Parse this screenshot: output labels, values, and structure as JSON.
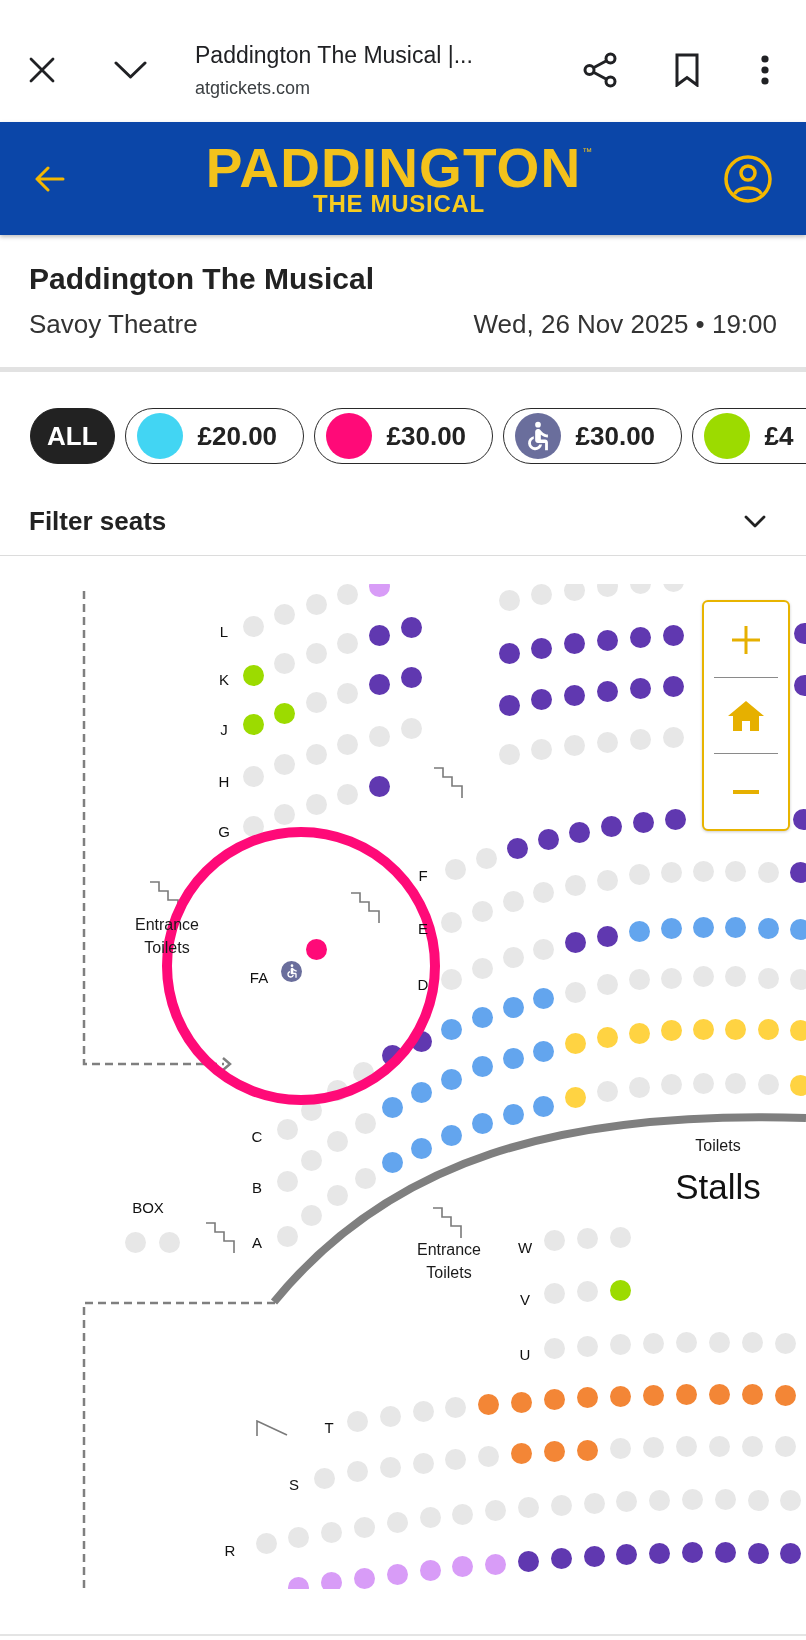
{
  "browser": {
    "title": "Paddington The Musical |...",
    "url": "atgtickets.com"
  },
  "banner": {
    "logo": "PADDINGTON",
    "logo_mark": "™",
    "tagline": "THE MUSICAL"
  },
  "event": {
    "title": "Paddington The Musical",
    "venue": "Savoy Theatre",
    "date": "Wed, 26 Nov 2025 • 19:00"
  },
  "price_filters": [
    {
      "kind": "all",
      "label": "ALL",
      "selected": true
    },
    {
      "kind": "price",
      "label": "£20.00",
      "color": "#42d5f3",
      "selected": false
    },
    {
      "kind": "price",
      "label": "£30.00",
      "color": "#ff0a78",
      "selected": false
    },
    {
      "kind": "access",
      "label": "£30.00",
      "color": "#6a6e9c",
      "selected": false
    },
    {
      "kind": "price",
      "label": "£4",
      "color": "#9cdb00",
      "selected": false
    }
  ],
  "filter": {
    "label": "Filter seats",
    "expanded": false
  },
  "seat_map": {
    "section": "Stalls",
    "area_labels": [
      "Entrance Toilets",
      "Entrance Toilets",
      "Toilets"
    ],
    "rows": [
      {
        "label": "L",
        "seats": [
          {
            "color": "#e7e7e7"
          },
          {
            "color": "#e7e7e7"
          },
          {
            "color": "#e7e7e7"
          },
          {
            "color": "#e7e7e7"
          },
          {
            "color": "#d89cf7"
          }
        ]
      },
      {
        "label": "K",
        "seats": [
          {
            "color": "#9cdb00"
          },
          {
            "color": "#e7e7e7"
          },
          {
            "color": "#e7e7e7"
          },
          {
            "color": "#e7e7e7"
          },
          {
            "color": "#6038b0"
          },
          {
            "color": "#6038b0"
          }
        ]
      },
      {
        "label": "J",
        "seats": [
          {
            "color": "#9cdb00"
          },
          {
            "color": "#9cdb00"
          },
          {
            "color": "#e7e7e7"
          },
          {
            "color": "#e7e7e7"
          },
          {
            "color": "#6038b0"
          },
          {
            "color": "#6038b0"
          }
        ]
      },
      {
        "label": "H",
        "seats": [
          {
            "color": "#e7e7e7"
          },
          {
            "color": "#e7e7e7"
          },
          {
            "color": "#e7e7e7"
          },
          {
            "color": "#e7e7e7"
          },
          {
            "color": "#e7e7e7"
          },
          {
            "color": "#e7e7e7"
          }
        ]
      },
      {
        "label": "G",
        "seats": [
          {
            "color": "#e7e7e7"
          },
          {
            "color": "#e7e7e7"
          },
          {
            "color": "#e7e7e7"
          },
          {
            "color": "#e7e7e7"
          },
          {
            "color": "#6038b0"
          }
        ]
      },
      {
        "seats": [
          {
            "color": "#e7e7e7"
          },
          {
            "color": "#e7e7e7"
          },
          {
            "color": "#e7e7e7"
          },
          {
            "color": "#e7e7e7"
          },
          {
            "color": "#e7e7e7"
          },
          {
            "color": "#e7e7e7"
          }
        ]
      },
      {
        "seats": [
          {
            "color": "#6038b0"
          },
          {
            "color": "#6038b0"
          },
          {
            "color": "#6038b0"
          },
          {
            "color": "#6038b0"
          },
          {
            "color": "#6038b0"
          },
          {
            "color": "#6038b0"
          },
          {
            "color": "#6038b0"
          }
        ]
      },
      {
        "seats": [
          {
            "color": "#6038b0"
          },
          {
            "color": "#6038b0"
          },
          {
            "color": "#6038b0"
          },
          {
            "color": "#6038b0"
          },
          {
            "color": "#6038b0"
          },
          {
            "color": "#6038b0"
          },
          {
            "color": "#6038b0"
          }
        ]
      },
      {
        "seats": [
          {
            "color": "#e7e7e7"
          },
          {
            "color": "#e7e7e7"
          },
          {
            "color": "#e7e7e7"
          },
          {
            "color": "#e7e7e7"
          },
          {
            "color": "#e7e7e7"
          },
          {
            "color": "#e7e7e7"
          }
        ]
      },
      {
        "label": "F",
        "seats": [
          {
            "color": "#e7e7e7"
          },
          {
            "color": "#e7e7e7"
          },
          {
            "color": "#6038b0"
          },
          {
            "color": "#6038b0"
          },
          {
            "color": "#6038b0"
          },
          {
            "color": "#6038b0"
          },
          {
            "color": "#6038b0"
          },
          {
            "color": "#6038b0"
          },
          {
            "color": "#6038b0"
          }
        ]
      },
      {
        "label": "E",
        "seats": [
          {
            "color": "#e7e7e7"
          },
          {
            "color": "#e7e7e7"
          },
          {
            "color": "#e7e7e7"
          },
          {
            "color": "#e7e7e7"
          },
          {
            "color": "#e7e7e7"
          },
          {
            "color": "#e7e7e7"
          },
          {
            "color": "#e7e7e7"
          },
          {
            "color": "#e7e7e7"
          },
          {
            "color": "#e7e7e7"
          },
          {
            "color": "#e7e7e7"
          },
          {
            "color": "#e7e7e7"
          },
          {
            "color": "#6038b0"
          }
        ]
      },
      {
        "label": "D",
        "seats": [
          {
            "color": "#e7e7e7"
          },
          {
            "color": "#e7e7e7"
          },
          {
            "color": "#e7e7e7"
          },
          {
            "color": "#e7e7e7"
          },
          {
            "color": "#6038b0"
          },
          {
            "color": "#6038b0"
          },
          {
            "color": "#63a5ee"
          },
          {
            "color": "#63a5ee"
          },
          {
            "color": "#63a5ee"
          },
          {
            "color": "#63a5ee"
          },
          {
            "color": "#63a5ee"
          },
          {
            "color": "#63a5ee"
          }
        ]
      },
      {
        "label": "FA",
        "highlighted": true,
        "seats": [
          {
            "kind": "wheelchair",
            "color": "#6a6e9c"
          },
          {
            "kind": "seat",
            "color": "#ff0a78"
          }
        ]
      },
      {
        "label": "C",
        "seats": [
          {
            "color": "#e7e7e7"
          },
          {
            "color": "#e7e7e7"
          },
          {
            "color": "#e7e7e7"
          },
          {
            "color": "#e7e7e7"
          },
          {
            "color": "#6038b0"
          },
          {
            "color": "#6038b0"
          },
          {
            "color": "#63a5ee"
          },
          {
            "color": "#63a5ee"
          },
          {
            "color": "#63a5ee"
          },
          {
            "color": "#63a5ee"
          },
          {
            "color": "#e7e7e7"
          },
          {
            "color": "#e7e7e7"
          },
          {
            "color": "#e7e7e7"
          },
          {
            "color": "#e7e7e7"
          },
          {
            "color": "#e7e7e7"
          },
          {
            "color": "#e7e7e7"
          },
          {
            "color": "#e7e7e7"
          },
          {
            "color": "#e7e7e7"
          }
        ]
      },
      {
        "label": "B",
        "seats": [
          {
            "color": "#e7e7e7"
          },
          {
            "color": "#e7e7e7"
          },
          {
            "color": "#e7e7e7"
          },
          {
            "color": "#e7e7e7"
          },
          {
            "color": "#63a5ee"
          },
          {
            "color": "#63a5ee"
          },
          {
            "color": "#63a5ee"
          },
          {
            "color": "#63a5ee"
          },
          {
            "color": "#63a5ee"
          },
          {
            "color": "#63a5ee"
          },
          {
            "color": "#ffd342"
          },
          {
            "color": "#ffd342"
          },
          {
            "color": "#ffd342"
          },
          {
            "color": "#ffd342"
          },
          {
            "color": "#ffd342"
          },
          {
            "color": "#ffd342"
          },
          {
            "color": "#ffd342"
          },
          {
            "color": "#ffd342"
          }
        ]
      },
      {
        "label": "A",
        "seats": [
          {
            "color": "#e7e7e7"
          },
          {
            "color": "#e7e7e7"
          },
          {
            "color": "#e7e7e7"
          },
          {
            "color": "#e7e7e7"
          },
          {
            "color": "#63a5ee"
          },
          {
            "color": "#63a5ee"
          },
          {
            "color": "#63a5ee"
          },
          {
            "color": "#63a5ee"
          },
          {
            "color": "#63a5ee"
          },
          {
            "color": "#63a5ee"
          },
          {
            "color": "#ffd342"
          },
          {
            "color": "#e7e7e7"
          },
          {
            "color": "#e7e7e7"
          },
          {
            "color": "#e7e7e7"
          },
          {
            "color": "#e7e7e7"
          },
          {
            "color": "#e7e7e7"
          },
          {
            "color": "#e7e7e7"
          },
          {
            "color": "#ffd342"
          }
        ]
      },
      {
        "label": "BOX",
        "seats": [
          {
            "color": "#e7e7e7"
          },
          {
            "color": "#e7e7e7"
          }
        ]
      },
      {
        "label": "W",
        "seats": [
          {
            "color": "#e7e7e7"
          },
          {
            "color": "#e7e7e7"
          },
          {
            "color": "#e7e7e7"
          }
        ]
      },
      {
        "label": "V",
        "seats": [
          {
            "color": "#e7e7e7"
          },
          {
            "color": "#e7e7e7"
          },
          {
            "color": "#9cdb00"
          }
        ]
      },
      {
        "label": "U",
        "seats": [
          {
            "color": "#e7e7e7"
          },
          {
            "color": "#e7e7e7"
          },
          {
            "color": "#e7e7e7"
          },
          {
            "color": "#e7e7e7"
          },
          {
            "color": "#e7e7e7"
          },
          {
            "color": "#e7e7e7"
          },
          {
            "color": "#e7e7e7"
          },
          {
            "color": "#e7e7e7"
          }
        ]
      },
      {
        "label": "T",
        "seats": [
          {
            "color": "#e7e7e7"
          },
          {
            "color": "#e7e7e7"
          },
          {
            "color": "#e7e7e7"
          },
          {
            "color": "#e7e7e7"
          },
          {
            "color": "#f38636"
          },
          {
            "color": "#f38636"
          },
          {
            "color": "#f38636"
          },
          {
            "color": "#f38636"
          },
          {
            "color": "#f38636"
          },
          {
            "color": "#f38636"
          },
          {
            "color": "#f38636"
          },
          {
            "color": "#f38636"
          },
          {
            "color": "#f38636"
          },
          {
            "color": "#f38636"
          }
        ]
      },
      {
        "label": "S",
        "seats": [
          {
            "color": "#e7e7e7"
          },
          {
            "color": "#e7e7e7"
          },
          {
            "color": "#e7e7e7"
          },
          {
            "color": "#e7e7e7"
          },
          {
            "color": "#e7e7e7"
          },
          {
            "color": "#e7e7e7"
          },
          {
            "color": "#f38636"
          },
          {
            "color": "#f38636"
          },
          {
            "color": "#f38636"
          },
          {
            "color": "#e7e7e7"
          },
          {
            "color": "#e7e7e7"
          },
          {
            "color": "#e7e7e7"
          },
          {
            "color": "#e7e7e7"
          },
          {
            "color": "#e7e7e7"
          },
          {
            "color": "#e7e7e7"
          }
        ]
      },
      {
        "label": "R",
        "seats": [
          {
            "color": "#e7e7e7"
          },
          {
            "color": "#e7e7e7"
          },
          {
            "color": "#e7e7e7"
          },
          {
            "color": "#e7e7e7"
          },
          {
            "color": "#e7e7e7"
          },
          {
            "color": "#e7e7e7"
          },
          {
            "color": "#e7e7e7"
          },
          {
            "color": "#e7e7e7"
          },
          {
            "color": "#e7e7e7"
          },
          {
            "color": "#e7e7e7"
          },
          {
            "color": "#e7e7e7"
          },
          {
            "color": "#e7e7e7"
          },
          {
            "color": "#e7e7e7"
          },
          {
            "color": "#e7e7e7"
          },
          {
            "color": "#e7e7e7"
          },
          {
            "color": "#e7e7e7"
          },
          {
            "color": "#e7e7e7"
          }
        ]
      },
      {
        "seats": [
          {
            "color": "#d89cf7"
          },
          {
            "color": "#d89cf7"
          },
          {
            "color": "#d89cf7"
          },
          {
            "color": "#d89cf7"
          },
          {
            "color": "#d89cf7"
          },
          {
            "color": "#d89cf7"
          },
          {
            "color": "#d89cf7"
          },
          {
            "color": "#6038b0"
          },
          {
            "color": "#6038b0"
          },
          {
            "color": "#6038b0"
          },
          {
            "color": "#6038b0"
          },
          {
            "color": "#6038b0"
          },
          {
            "color": "#6038b0"
          },
          {
            "color": "#6038b0"
          },
          {
            "color": "#6038b0"
          },
          {
            "color": "#6038b0"
          }
        ]
      }
    ]
  }
}
